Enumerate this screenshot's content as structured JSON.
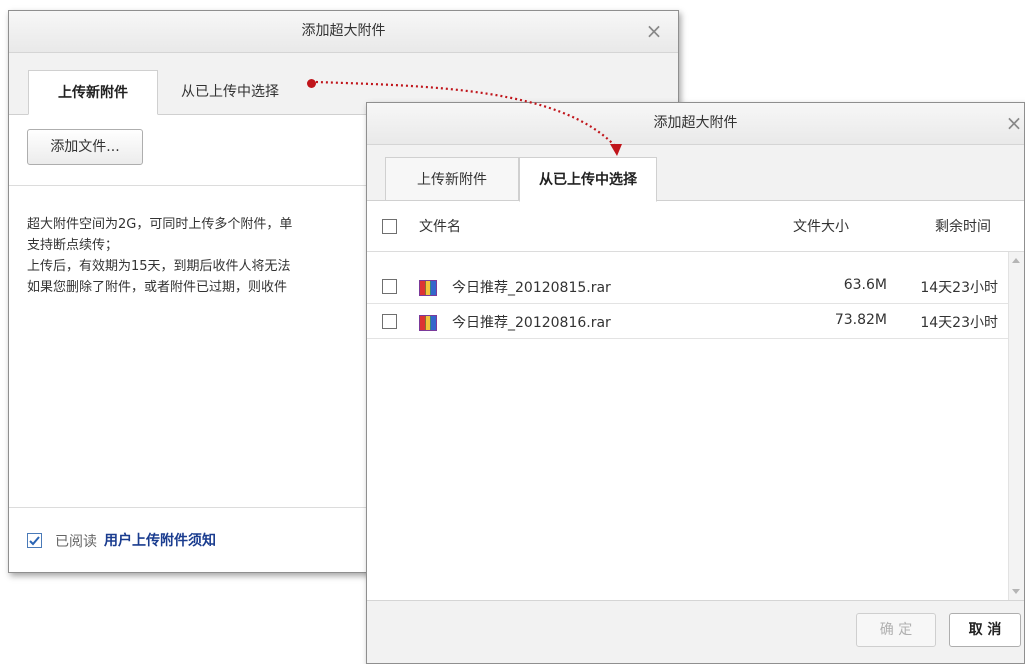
{
  "dialog_back": {
    "title": "添加超大附件",
    "close_glyph": "×",
    "tabs": [
      {
        "label": "上传新附件",
        "active": true
      },
      {
        "label": "从已上传中选择",
        "active": false
      }
    ],
    "add_file_label": "添加文件...",
    "info_lines": [
      "超大附件空间为2G，可同时上传多个附件，单",
      "支持断点续传；",
      "上传后，有效期为15天，到期后收件人将无法",
      "如果您删除了附件，或者附件已过期，则收件"
    ],
    "agree_checked": true,
    "agree_label": "已阅读",
    "agree_link": "用户上传附件须知"
  },
  "dialog_front": {
    "title": "添加超大附件",
    "close_glyph": "×",
    "tabs": [
      {
        "label": "上传新附件",
        "active": false
      },
      {
        "label": "从已上传中选择",
        "active": true
      }
    ],
    "columns": {
      "name": "文件名",
      "size": "文件大小",
      "remaining": "剩余时间"
    },
    "files": [
      {
        "name": "今日推荐_20120815.rar",
        "size": "63.6M",
        "remaining": "14天23小时",
        "icon": "rar-archive-icon"
      },
      {
        "name": "今日推荐_20120816.rar",
        "size": "73.82M",
        "remaining": "14天23小时",
        "icon": "rar-archive-icon"
      }
    ],
    "confirm_label": "确 定",
    "cancel_label": "取 消"
  },
  "colors": {
    "arrow": "#c0151b",
    "link": "#1a3c8f",
    "checkbox_accent": "#2a64b4"
  }
}
